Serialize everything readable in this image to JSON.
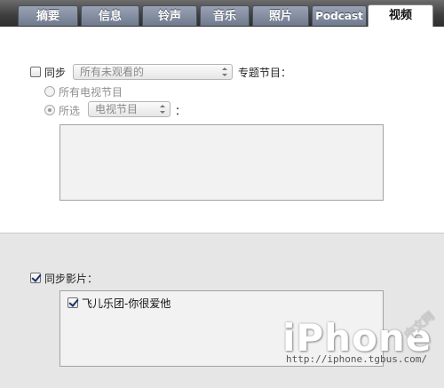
{
  "tabs": [
    {
      "label": "摘要"
    },
    {
      "label": "信息"
    },
    {
      "label": "铃声"
    },
    {
      "label": "音乐"
    },
    {
      "label": "照片"
    },
    {
      "label": "Podcast"
    },
    {
      "label": "视频"
    }
  ],
  "tv": {
    "sync_label": "同步",
    "sync_checked": false,
    "episodes_select": "所有未观看的",
    "topic_label": "专题节目：",
    "radio_all": "所有电视节目",
    "radio_selected": "所选",
    "selected_select": "电视节目",
    "colon": "："
  },
  "movies": {
    "sync_label": "同步影片：",
    "sync_checked": true,
    "items": [
      {
        "label": "飞儿乐团-你很爱他",
        "checked": true
      }
    ]
  },
  "watermark": {
    "brand": "iPhone",
    "cn": "中文网",
    "url": "http://iphone.tgbus.com/"
  }
}
